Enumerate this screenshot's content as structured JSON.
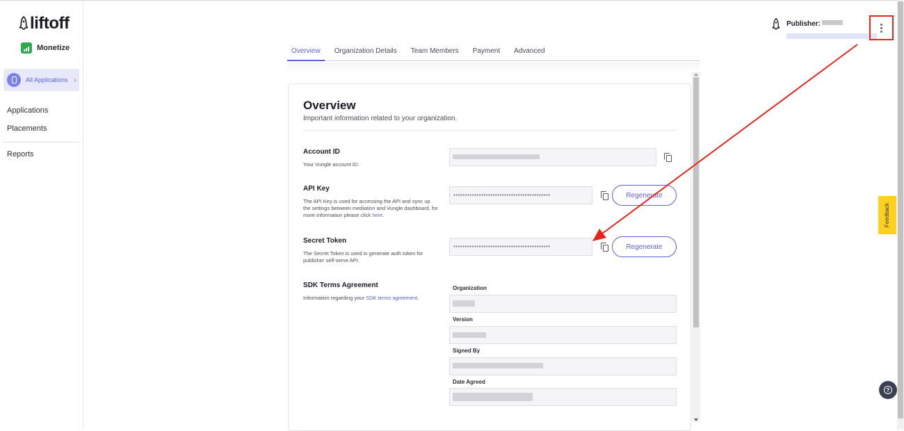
{
  "brand": {
    "logo_text": "liftoff",
    "product": "Monetize"
  },
  "sidebar": {
    "app_selector": "All Applications",
    "items": [
      {
        "label": "Applications"
      },
      {
        "label": "Placements"
      },
      {
        "label": "Reports"
      }
    ]
  },
  "header": {
    "publisher_label": "Publisher:"
  },
  "tabs": [
    "Overview",
    "Organization Details",
    "Team Members",
    "Payment",
    "Advanced"
  ],
  "overview": {
    "title": "Overview",
    "subtitle": "Important information related to your organization.",
    "account_id": {
      "title": "Account ID",
      "desc": "Your Vungle account ID."
    },
    "api_key": {
      "title": "API Key",
      "desc": "The API Key is used for accessing the API and sync up the settings between mediation and Vungle dashboard, for more information please click ",
      "link": "here",
      "desc_end": ".",
      "value": "******************************************",
      "button": "Regenerate"
    },
    "secret_token": {
      "title": "Secret Token",
      "desc": "The Secret Token is used in generate auth token for publisher self-serve API.",
      "value": "******************************************",
      "button": "Regenerate"
    },
    "sdk_terms": {
      "title": "SDK Terms Agreement",
      "desc": "Information regarding your ",
      "link": "SDK terms agreement",
      "desc_end": ".",
      "fields": [
        "Organization",
        "Version",
        "Signed By",
        "Date Agreed"
      ]
    }
  },
  "feedback_label": "Feedback",
  "colors": {
    "accent": "#5a61d9",
    "brand_green": "#2fa84f",
    "annotation_red": "#e8251c",
    "feedback_yellow": "#ffd01f"
  }
}
